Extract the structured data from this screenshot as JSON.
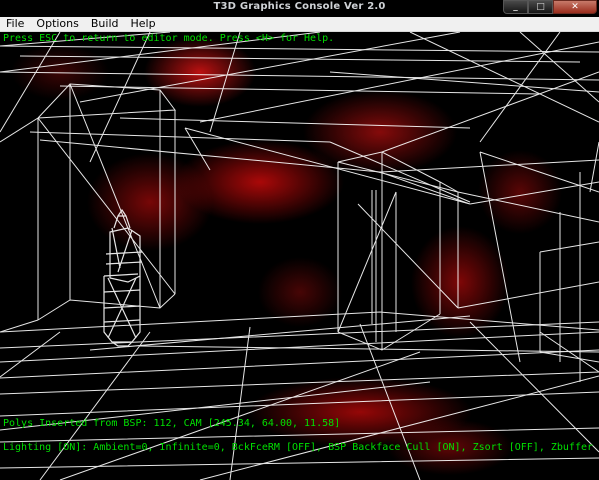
{
  "window": {
    "title": "T3D Graphics Console Ver 2.0"
  },
  "menu": {
    "items": [
      "File",
      "Options",
      "Build",
      "Help"
    ]
  },
  "hud": {
    "help_line": "Press ESC to return to editor mode. Press <H> for Help.",
    "stats_line": "Polys Inserted from BSP: 112, CAM [245.34, 64.00, 11.58]",
    "status_line": "Lighting [ON]: Ambient=0, Infinite=0, BckFceRM [OFF], BSP Backface Cull [ON], Zsort [OFF], Zbuffer [ON]"
  },
  "colors": {
    "hud_text": "#00e000",
    "wireframe": "#ffffff",
    "fog": "#c81414",
    "background": "#000000"
  },
  "icons": {
    "minimize": "minimize-icon",
    "maximize": "maximize-icon",
    "close": "close-icon"
  }
}
